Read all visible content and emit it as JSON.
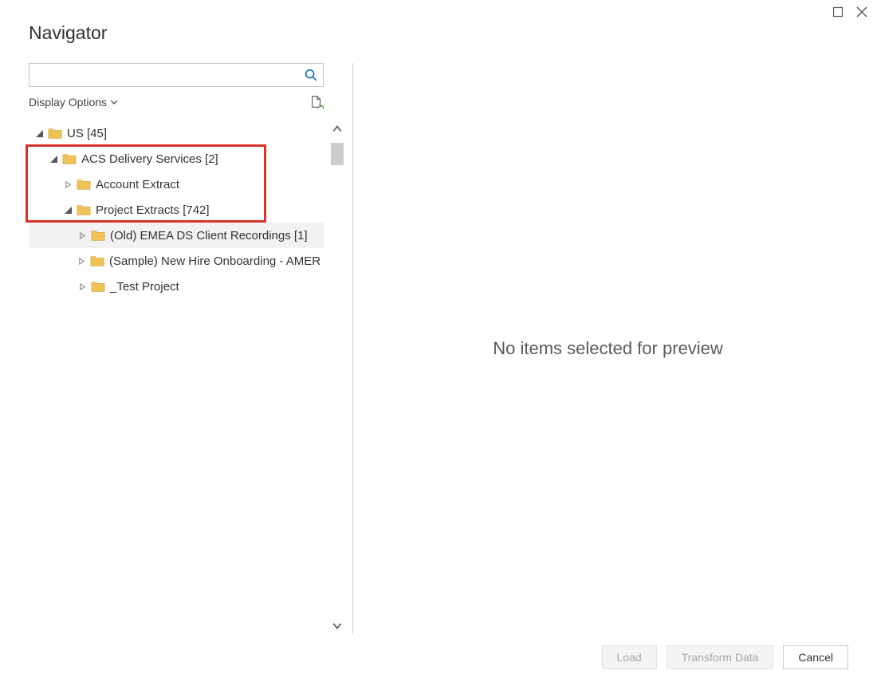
{
  "title": "Navigator",
  "displayOptionsLabel": "Display Options",
  "previewMessage": "No items selected for preview",
  "tree": {
    "node0": "US [45]",
    "node1": "ACS Delivery Services [2]",
    "node2": "Account Extract",
    "node3": "Project Extracts [742]",
    "node4": "(Old) EMEA DS Client Recordings [1]",
    "node5": "(Sample) New Hire Onboarding - AMER",
    "node6": "_Test Project"
  },
  "footer": {
    "load": "Load",
    "transform": "Transform Data",
    "cancel": "Cancel"
  }
}
